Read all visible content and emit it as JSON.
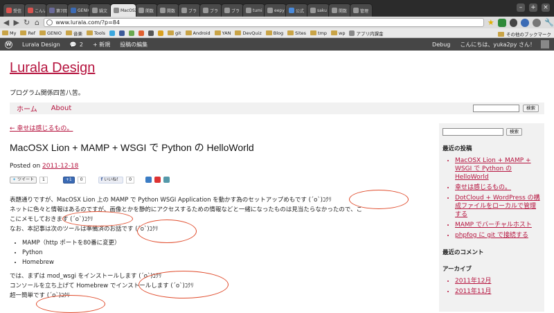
{
  "browser": {
    "tabs": [
      {
        "label": "受信",
        "color": "#d9534f"
      },
      {
        "label": "こんい",
        "color": "#d9534f"
      },
      {
        "label": "第7回",
        "color": "#6a6a9a"
      },
      {
        "label": "GENIO",
        "color": "#3b6bb5"
      },
      {
        "label": "鍋文",
        "color": "#999999"
      },
      {
        "label": "MacOSX",
        "color": "#888888",
        "active": true
      },
      {
        "label": "開数",
        "color": "#999999"
      },
      {
        "label": "開数",
        "color": "#999999"
      },
      {
        "label": "ブラ",
        "color": "#999999"
      },
      {
        "label": "ブラ",
        "color": "#999999"
      },
      {
        "label": "ブラ",
        "color": "#999999"
      },
      {
        "label": "tumi",
        "color": "#999999"
      },
      {
        "label": "eepy",
        "color": "#999999"
      },
      {
        "label": "公式",
        "color": "#4a8bdc"
      },
      {
        "label": "saku",
        "color": "#999999"
      },
      {
        "label": "開数",
        "color": "#999999"
      },
      {
        "label": "管理",
        "color": "#999999"
      }
    ],
    "url": "www.lurala.com/?p=84",
    "bookmarks": [
      "My",
      "Ref",
      "GENIO",
      "音楽",
      "Tools",
      "git",
      "Android",
      "YAN",
      "DevQuiz",
      "Blog",
      "Sites",
      "tmp",
      "wp",
      "アプリ内課金"
    ],
    "other_bookmarks": "その他のブックマーク"
  },
  "adminbar": {
    "site_name": "Lurala Design",
    "comments": "2",
    "new_label": "+ 新規",
    "edit_label": "投稿の編集",
    "debug_label": "Debug",
    "greeting": "こんにちは、yuka2py さん！"
  },
  "site": {
    "title": "Lurala Design",
    "description": "プログラム関係四苦八苦。",
    "menu": [
      "ホーム",
      "About"
    ],
    "search_button": "検索"
  },
  "post": {
    "prev_link": "← 幸せは感じるもの。",
    "title": "MacOSX Lion + MAMP + WSGI で Python の HelloWorld",
    "posted_on": "Posted on",
    "date": "2011-12-18",
    "social": {
      "tweet": "ツイート",
      "tweet_count": "1",
      "gplus": "+1",
      "gplus_count": "0",
      "like": "いいね！",
      "like_count": "0"
    },
    "paragraphs_1": [
      "表題通りですが、MacOSX Lion 上の MAMP で Python WSGI Application を動かす為のセットアップめもです (´ο`)ｺｸﾘ",
      "ネットに色々と情報はあるのですが、画像とかを静的にアクセスするための情報などと一緒になったものは見当たらなかったので、こ",
      "こにメモしておきます (´ο`)ｺｸﾘ",
      "なお、本記事は次のツールは準備済のお話です (´ο`)ｺｸﾘ"
    ],
    "list": [
      "MAMP（http ポートを80番に変更）",
      "Python",
      "Homebrew"
    ],
    "paragraphs_2": [
      "では、まずは mod_wsgi をインストールします (´ο`)ｺｸﾘ",
      "コンソールを立ち上げて Homebrew でインストールします (´ο`)ｺｸﾘ",
      "超一簡単です (´ο`)ｺｸﾘ"
    ]
  },
  "sidebar": {
    "search_button": "検索",
    "recent_posts_heading": "最近の投稿",
    "recent_posts": [
      "MacOSX Lion + MAMP + WSGI で Python の HelloWorld",
      "幸せは感じるもの。",
      "DotCloud + WordPress の構成ファイルをローカルで管理する",
      "MAMP でバーチャルホスト",
      "phpfog に git で接続する"
    ],
    "recent_comments_heading": "最近のコメント",
    "archives_heading": "アーカイブ",
    "archives": [
      "2011年12月",
      "2011年11月"
    ]
  },
  "colors": {
    "link": "#b5123d",
    "annotation": "#e04a2a"
  }
}
